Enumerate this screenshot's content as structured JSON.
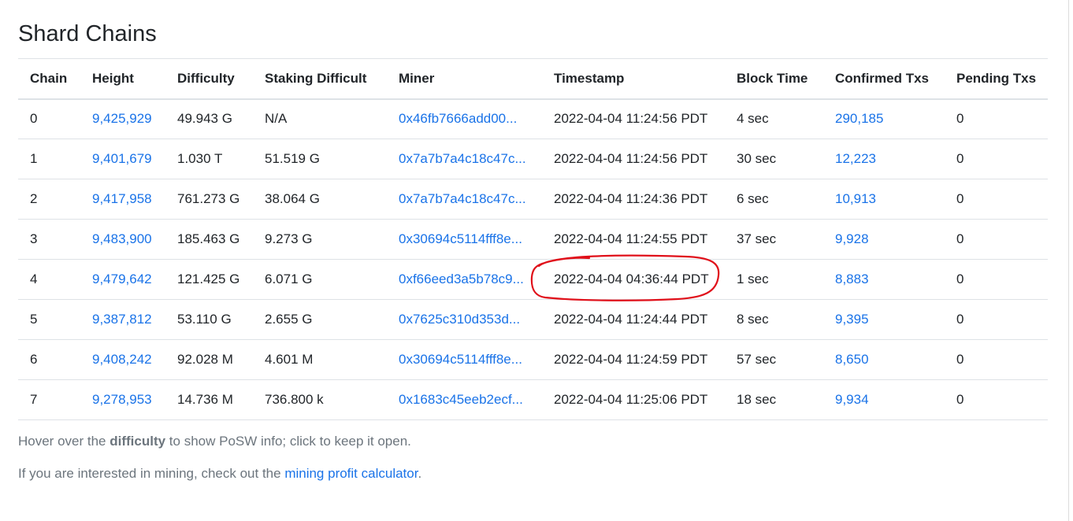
{
  "page": {
    "title": "Shard Chains"
  },
  "table": {
    "headers": {
      "chain": "Chain",
      "height": "Height",
      "difficulty": "Difficulty",
      "staking": "Staking Difficult",
      "miner": "Miner",
      "timestamp": "Timestamp",
      "block_time": "Block Time",
      "confirmed": "Confirmed Txs",
      "pending": "Pending Txs"
    },
    "rows": [
      {
        "chain": "0",
        "height": "9,425,929",
        "difficulty": "49.943 G",
        "staking": "N/A",
        "miner": "0x46fb7666add00...",
        "timestamp": "2022-04-04 11:24:56 PDT",
        "block_time": "4 sec",
        "confirmed": "290,185",
        "pending": "0"
      },
      {
        "chain": "1",
        "height": "9,401,679",
        "difficulty": "1.030 T",
        "staking": "51.519 G",
        "miner": "0x7a7b7a4c18c47c...",
        "timestamp": "2022-04-04 11:24:56 PDT",
        "block_time": "30 sec",
        "confirmed": "12,223",
        "pending": "0"
      },
      {
        "chain": "2",
        "height": "9,417,958",
        "difficulty": "761.273 G",
        "staking": "38.064 G",
        "miner": "0x7a7b7a4c18c47c...",
        "timestamp": "2022-04-04 11:24:36 PDT",
        "block_time": "6 sec",
        "confirmed": "10,913",
        "pending": "0"
      },
      {
        "chain": "3",
        "height": "9,483,900",
        "difficulty": "185.463 G",
        "staking": "9.273 G",
        "miner": "0x30694c5114fff8e...",
        "timestamp": "2022-04-04 11:24:55 PDT",
        "block_time": "37 sec",
        "confirmed": "9,928",
        "pending": "0"
      },
      {
        "chain": "4",
        "height": "9,479,642",
        "difficulty": "121.425 G",
        "staking": "6.071 G",
        "miner": "0xf66eed3a5b78c9...",
        "timestamp": "2022-04-04 04:36:44 PDT",
        "block_time": "1 sec",
        "confirmed": "8,883",
        "pending": "0"
      },
      {
        "chain": "5",
        "height": "9,387,812",
        "difficulty": "53.110 G",
        "staking": "2.655 G",
        "miner": "0x7625c310d353d...",
        "timestamp": "2022-04-04 11:24:44 PDT",
        "block_time": "8 sec",
        "confirmed": "9,395",
        "pending": "0"
      },
      {
        "chain": "6",
        "height": "9,408,242",
        "difficulty": "92.028 M",
        "staking": "4.601 M",
        "miner": "0x30694c5114fff8e...",
        "timestamp": "2022-04-04 11:24:59 PDT",
        "block_time": "57 sec",
        "confirmed": "8,650",
        "pending": "0"
      },
      {
        "chain": "7",
        "height": "9,278,953",
        "difficulty": "14.736 M",
        "staking": "736.800 k",
        "miner": "0x1683c45eeb2ecf...",
        "timestamp": "2022-04-04 11:25:06 PDT",
        "block_time": "18 sec",
        "confirmed": "9,934",
        "pending": "0"
      }
    ]
  },
  "footer": {
    "hover_prefix": "Hover over the ",
    "hover_bold": "difficulty",
    "hover_suffix": " to show PoSW info; click to keep it open.",
    "mining_prefix": "If you are interested in mining, check out the ",
    "mining_link": "mining profit calculator",
    "mining_suffix": "."
  },
  "colors": {
    "link": "#1a73e8",
    "annotation": "#e0101a",
    "muted_text": "#6c757d"
  }
}
